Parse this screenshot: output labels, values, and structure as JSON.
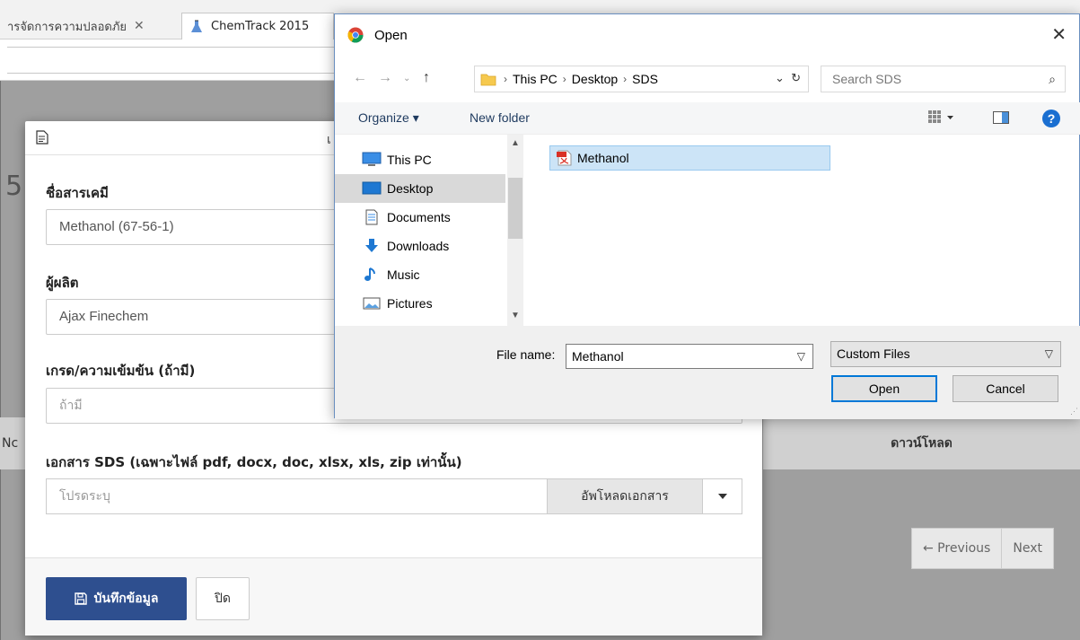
{
  "browser": {
    "tabs": [
      {
        "label": "ารจัดการความปลอดภัย",
        "active": false
      },
      {
        "label": "ChemTrack 2015",
        "active": true
      }
    ]
  },
  "background": {
    "left_col_fragment": "Nc",
    "download_header": "ดาวน์โหลด",
    "big_glyph": "5",
    "pagination": {
      "previous": "← Previous",
      "next": "Next"
    }
  },
  "modal": {
    "title_fragment": "เ",
    "fields": {
      "chemical_name": {
        "label": "ชื่อสารเคมี",
        "value": "Methanol (67-56-1)"
      },
      "manufacturer": {
        "label": "ผู้ผลิต",
        "value": "Ajax Finechem"
      },
      "grade": {
        "label": "เกรด/ความเข้มข้น (ถ้ามี)",
        "placeholder": "ถ้ามี"
      },
      "sds": {
        "label": "เอกสาร SDS (เฉพาะไฟล์ pdf, docx, doc, xlsx, xls, zip เท่านั้น)",
        "placeholder": "โปรดระบุ",
        "upload_label": "อัพโหลดเอกสาร"
      }
    },
    "footer": {
      "save_label": "บันทึกข้อมูล",
      "close_label": "ปิด"
    },
    "colors": {
      "primary": "#2e4f8f"
    }
  },
  "file_dialog": {
    "title": "Open",
    "breadcrumb": [
      "This PC",
      "Desktop",
      "SDS"
    ],
    "search_placeholder": "Search SDS",
    "toolbar": {
      "organize": "Organize ▾",
      "new_folder": "New folder",
      "help": "?"
    },
    "nav_items": [
      {
        "label": "This PC",
        "icon": "computer-icon",
        "selected": false
      },
      {
        "label": "Desktop",
        "icon": "desktop-icon",
        "selected": true
      },
      {
        "label": "Documents",
        "icon": "documents-icon",
        "selected": false
      },
      {
        "label": "Downloads",
        "icon": "downloads-icon",
        "selected": false
      },
      {
        "label": "Music",
        "icon": "music-icon",
        "selected": false
      },
      {
        "label": "Pictures",
        "icon": "pictures-icon",
        "selected": false
      }
    ],
    "files": [
      {
        "name": "Methanol",
        "type": "pdf",
        "selected": true
      }
    ],
    "file_name_label": "File name:",
    "file_name_value": "Methanol",
    "filter_value": "Custom Files",
    "open_label": "Open",
    "cancel_label": "Cancel",
    "colors": {
      "accent": "#0078d7",
      "selection": "#cce4f7"
    }
  }
}
